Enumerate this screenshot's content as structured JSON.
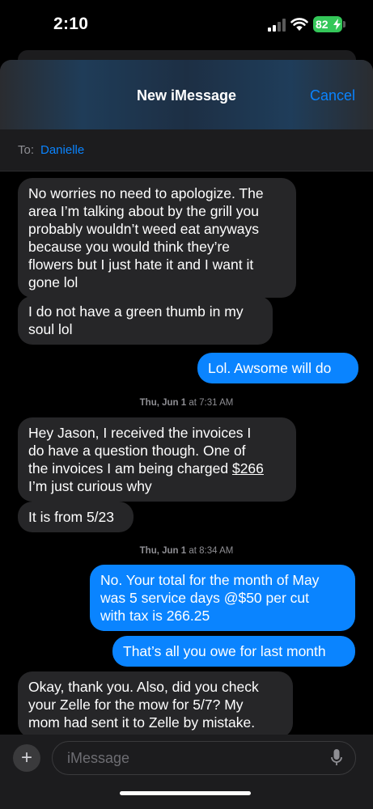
{
  "status": {
    "time": "2:10",
    "battery": "82"
  },
  "header": {
    "title": "New iMessage",
    "cancel_label": "Cancel"
  },
  "to": {
    "label": "To:",
    "recipient": "Danielle"
  },
  "messages": [
    {
      "text": "No worries no need to apologize. The\narea I’m talking about by the grill you\nprobably wouldn’t weed eat anyways\nbecause you would think they’re\nflowers but I just hate it and  I want it\ngone lol"
    },
    {
      "text": "I do not have a green thumb in my\nsoul lol"
    },
    {
      "text": "Lol. Awsome will do"
    },
    {
      "text_before": "Hey Jason, I received the invoices I\ndo have a question though. One of\nthe invoices I am being charged ",
      "amount": "$266",
      "text_after": "\nI’m just curious why"
    },
    {
      "text": "It is from 5/23"
    },
    {
      "text": "No. Your total for the month of May\nwas 5 service days @$50 per cut\nwith tax is 266.25"
    },
    {
      "text": "That’s all you owe for last month"
    },
    {
      "text": "Okay, thank you. Also, did you check\nyour Zelle for the mow for 5/7? My\nmom had sent it to Zelle by mistake."
    }
  ],
  "timestamps": [
    {
      "day": "Thu, Jun 1",
      "time": "at 7:31 AM"
    },
    {
      "day": "Thu, Jun 1",
      "time": "at 8:34 AM"
    }
  ],
  "input": {
    "placeholder": "iMessage",
    "plus_symbol": "+"
  },
  "colors": {
    "outgoing": "#0a84ff",
    "incoming": "#262628",
    "accent": "#0a84ff",
    "battery": "#34c759"
  },
  "icons": [
    "signal-icon",
    "wifi-icon",
    "battery-icon",
    "plus-icon",
    "microphone-icon"
  ]
}
